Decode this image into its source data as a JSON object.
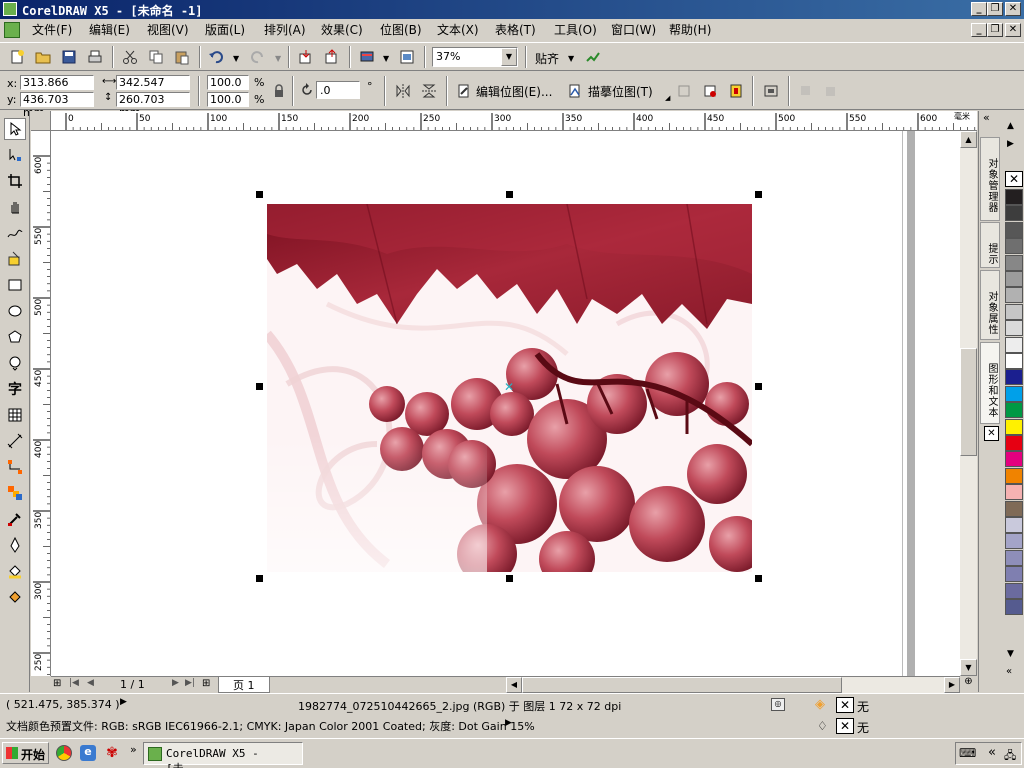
{
  "window": {
    "title": "CorelDRAW X5 - [未命名 -1]",
    "minimize_label": "_",
    "restore_label": "❐",
    "close_label": "✕"
  },
  "menu": {
    "items": [
      "文件(F)",
      "编辑(E)",
      "视图(V)",
      "版面(L)",
      "排列(A)",
      "效果(C)",
      "位图(B)",
      "文本(X)",
      "表格(T)",
      "工具(O)",
      "窗口(W)",
      "帮助(H)"
    ]
  },
  "standard_toolbar": {
    "zoom_value": "37%",
    "snap_label": "贴齐"
  },
  "property_bar": {
    "x_label": "x:",
    "x_value": "313.866 mm",
    "y_label": "y:",
    "y_value": "436.703 mm",
    "width_value": "342.547 mm",
    "height_value": "260.703 mm",
    "scale_w": "100.0",
    "scale_h": "100.0",
    "percent": "%",
    "rotation_value": ".0",
    "degree": "°",
    "edit_bitmap_label": "编辑位图(E)...",
    "trace_bitmap_label": "描摹位图(T)"
  },
  "ruler": {
    "units": "毫米",
    "h_ticks": [
      "0",
      "50",
      "100",
      "150",
      "200",
      "250",
      "300",
      "350",
      "400",
      "450",
      "500",
      "550",
      "600"
    ],
    "v_ticks": [
      "600",
      "550",
      "500",
      "450",
      "400",
      "350",
      "300",
      "250"
    ]
  },
  "page_nav": {
    "page_count": "1 / 1",
    "page_tab": "页 1"
  },
  "status": {
    "coords": "( 521.475, 385.374 )",
    "object_info": "1982774_072510442665_2.jpg (RGB) 于 图层 1 72 x 72 dpi",
    "color_profile": "文档颜色预置文件: RGB: sRGB IEC61966-2.1; CMYK: Japan Color 2001 Coated; 灰度: Dot Gain 15%",
    "fill_none": "无",
    "outline_none": "无"
  },
  "dockers": {
    "tabs": [
      "对象管理器",
      "提示",
      "对象属性",
      "图形和文本"
    ]
  },
  "palette": {
    "colors": [
      "#231f20",
      "#3d3d3d",
      "#575757",
      "#6f6f6f",
      "#878787",
      "#9c9c9c",
      "#b1b1b1",
      "#c6c6c6",
      "#dadada",
      "#ededed",
      "#ffffff",
      "#1b1f8f",
      "#00a0e9",
      "#009944",
      "#fff100",
      "#e60012",
      "#e4007f",
      "#f08300",
      "#f5b2b2",
      "#7f6a57",
      "#c9c9dc",
      "#a4a4c8",
      "#8e8eb9",
      "#7f7fb0",
      "#6b6b9f",
      "#555b8f"
    ]
  },
  "taskbar": {
    "start_label": "开始",
    "task_label": "CorelDRAW X5 - [未..."
  },
  "canvas": {
    "image_alt": "red grapes with leaves bitmap"
  }
}
